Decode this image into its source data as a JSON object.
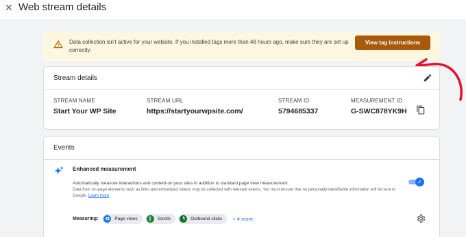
{
  "header": {
    "title": "Web stream details"
  },
  "alert": {
    "message": "Data collection isn't active for your website. If you installed tags more than 48 hours ago, make sure they are set up correctly.",
    "button_label": "View tag instructions"
  },
  "stream_details": {
    "title": "Stream details",
    "fields": [
      {
        "label": "STREAM NAME",
        "value": "Start Your WP Site"
      },
      {
        "label": "STREAM URL",
        "value": "https://startyourwpsite.com/"
      },
      {
        "label": "STREAM ID",
        "value": "5794685337"
      },
      {
        "label": "MEASUREMENT ID",
        "value": "G-SWC878YK9H"
      }
    ]
  },
  "events": {
    "title": "Events",
    "enhanced": {
      "title": "Enhanced measurement",
      "description": "Automatically measure interactions and content on your sites in addition to standard page view measurement.",
      "description2": "Data from on-page elements such as links and embedded videos may be collected with relevant events. You must ensure that no personally-identifiable information will be sent to Google.",
      "learn_more": "Learn more",
      "enabled": true
    },
    "measuring": {
      "label": "Measuring:",
      "chips": [
        "Page views",
        "Scrolls",
        "Outbound clicks"
      ],
      "more": "+ 4 more"
    }
  },
  "colors": {
    "alert_bg": "#fef7e0",
    "button": "#a85a0b",
    "accent": "#1a73e8",
    "annotation_arrow": "#e8112d"
  }
}
